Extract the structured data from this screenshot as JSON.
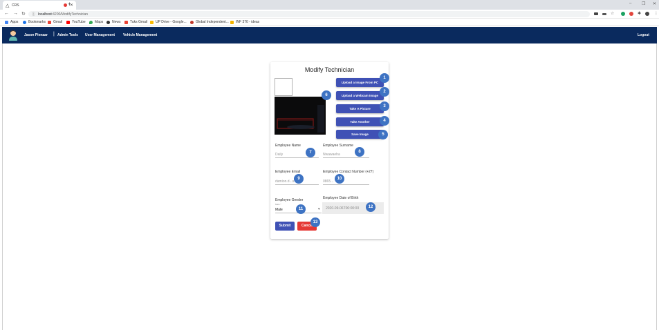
{
  "browser": {
    "tab_title": "CRS",
    "url_host": "localhost",
    "url_path": ":4200/ModifyTechnician",
    "bookmarks": [
      "Apps",
      "Bookmarks",
      "Gmail",
      "YouTube",
      "Maps",
      "News",
      "Tuks Gmail",
      "UP Drive - Google...",
      "Global Independent...",
      "INF 370 - ideas"
    ]
  },
  "navbar": {
    "user_name": "Jason Pienaar",
    "separator": "|",
    "links": [
      "Admin Tools",
      "User Management",
      "Vehicle Management"
    ],
    "logout": "Logout"
  },
  "form": {
    "title": "Modify Technician",
    "buttons": [
      "Upload a Image From PC",
      "Upload a Webcam Image",
      "Take A Picture",
      "Take Another",
      "Save Image"
    ],
    "fields": {
      "name": {
        "label": "Employee Name",
        "value": "Daily"
      },
      "surname": {
        "label": "Employee Surname",
        "value": "Nwawaeha"
      },
      "email": {
        "label": "Employee Email",
        "value": "damion.d...s.com"
      },
      "contact": {
        "label": "Employee Contact Number (+27)",
        "value": "0865..."
      },
      "gender": {
        "label": "Employee Gender",
        "small_label": "Male *",
        "value": "Male"
      },
      "dob": {
        "label": "Employee Date of Birth",
        "value": "2020-09-06T00:00:00"
      }
    },
    "submit": "Submit",
    "cancel": "Cancel"
  },
  "badges": [
    "1",
    "2",
    "3",
    "4",
    "5",
    "6",
    "7",
    "8",
    "9",
    "10",
    "11",
    "12",
    "13"
  ],
  "colors": {
    "navbar": "#0a2a5e",
    "primary_button": "#3f51b5",
    "cancel_button": "#e53935",
    "badge": "#3e73c3"
  }
}
